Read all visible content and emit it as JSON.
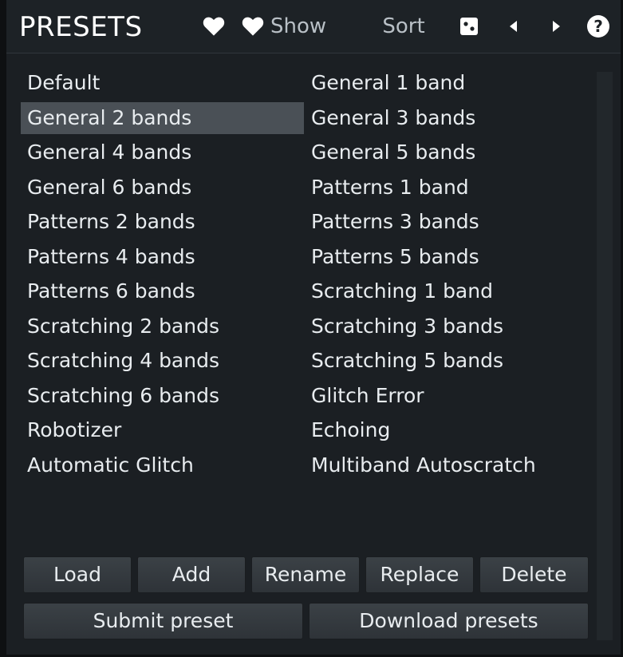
{
  "header": {
    "title": "PRESETS",
    "show_label": "Show",
    "sort_label": "Sort"
  },
  "presets": {
    "selected": "General 2 bands",
    "left": [
      "Default",
      "General 2 bands",
      "General 4 bands",
      "General 6 bands",
      "Patterns 2 bands",
      "Patterns 4 bands",
      "Patterns 6 bands",
      "Scratching 2 bands",
      "Scratching 4 bands",
      "Scratching 6 bands",
      "Robotizer",
      "Automatic Glitch"
    ],
    "right": [
      "General 1 band",
      "General 3 bands",
      "General 5 bands",
      "Patterns 1 band",
      "Patterns 3 bands",
      "Patterns 5 bands",
      "Scratching 1 band",
      "Scratching 3 bands",
      "Scratching 5 bands",
      "Glitch Error",
      "Echoing",
      "Multiband Autoscratch"
    ]
  },
  "buttons": {
    "load": "Load",
    "add": "Add",
    "rename": "Rename",
    "replace": "Replace",
    "delete": "Delete",
    "submit": "Submit preset",
    "download": "Download presets"
  },
  "icons": [
    "heart-icon",
    "heart-show-icon",
    "dice-icon",
    "previous-icon",
    "next-icon",
    "help-icon"
  ],
  "colors": {
    "background": "#1b1f23",
    "selected_row": "#4a5056",
    "text": "#e8ecef"
  }
}
